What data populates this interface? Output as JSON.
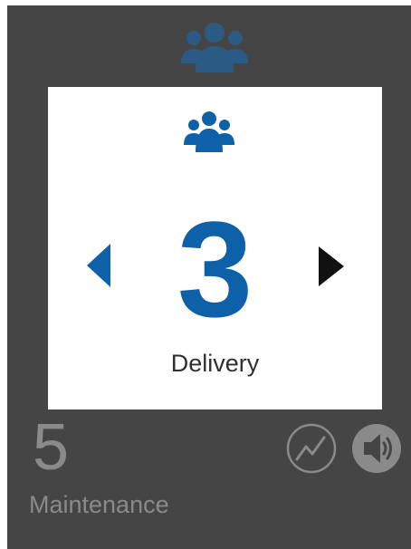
{
  "current_item": {
    "icon": "group-icon",
    "value": "3",
    "label": "Delivery"
  },
  "next_item": {
    "value": "5",
    "label": "Maintenance"
  },
  "controls": {
    "prev_icon": "caret-left-icon",
    "next_icon": "caret-right-icon",
    "chart_icon": "trend-chart-icon",
    "sound_icon": "speaker-icon"
  },
  "colors": {
    "panel_background": "#464545",
    "accent_blue": "#0e61a8",
    "faded_icon": "#2b5b85",
    "muted_gray": "#8a8a8a"
  }
}
